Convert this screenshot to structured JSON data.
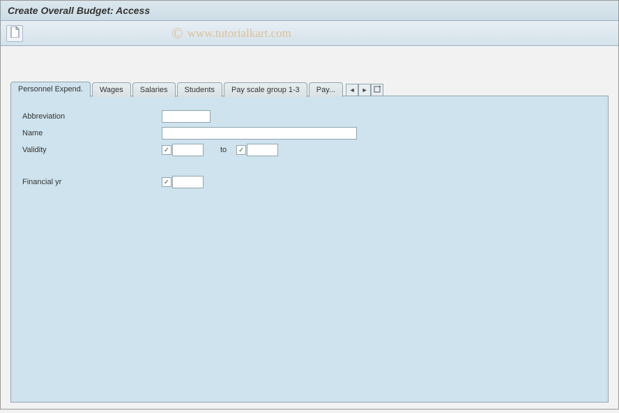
{
  "header": {
    "title": "Create Overall Budget: Access"
  },
  "toolbar": {
    "new_doc": "New"
  },
  "watermark": {
    "symbol": "©",
    "text": "www.tutorialkart.com"
  },
  "tabs": {
    "items": [
      {
        "label": "Personnel Expend.",
        "active": true
      },
      {
        "label": "Wages",
        "active": false
      },
      {
        "label": "Salaries",
        "active": false
      },
      {
        "label": "Students",
        "active": false
      },
      {
        "label": "Pay scale group 1-3",
        "active": false
      },
      {
        "label": "Pay...",
        "active": false
      }
    ],
    "nav_prev": "◄",
    "nav_next": "►",
    "nav_list": "☐"
  },
  "form": {
    "abbreviation": {
      "label": "Abbreviation",
      "value": ""
    },
    "name": {
      "label": "Name",
      "value": ""
    },
    "validity": {
      "label": "Validity",
      "from": "",
      "to_label": "to",
      "to": ""
    },
    "financial_yr": {
      "label": "Financial yr",
      "value": ""
    }
  },
  "icons": {
    "check": "✓"
  }
}
